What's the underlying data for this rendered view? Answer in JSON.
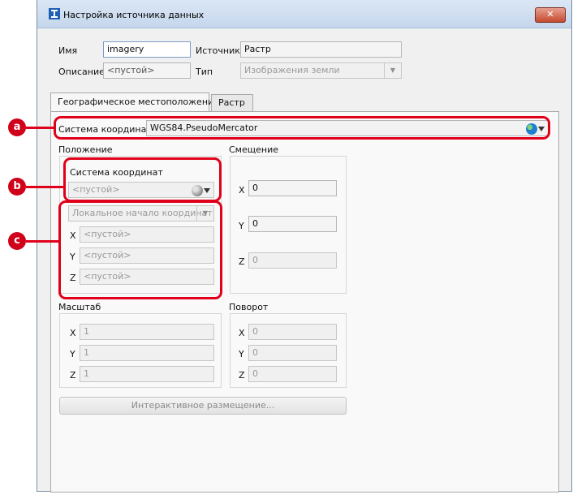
{
  "window": {
    "title": "Настройка источника данных",
    "close_glyph": "✕"
  },
  "form": {
    "name_label": "Имя",
    "name_value": "imagery",
    "source_label": "Источник",
    "source_value": "Растр",
    "description_label": "Описание",
    "description_value": "<пустой>",
    "type_label": "Тип",
    "type_value": "Изображения земли"
  },
  "tabs": [
    {
      "label": "Географическое местоположение",
      "active": true
    },
    {
      "label": "Растр",
      "active": false
    }
  ],
  "geo": {
    "crs_label": "Система координат",
    "crs_value": "WGS84.PseudoMercator",
    "position_label": "Положение",
    "position_crs_label": "Система координат",
    "position_crs_value": "<пустой>",
    "local_origin_value": "Локальное начало координат",
    "pos_x_label": "X",
    "pos_x_value": "<пустой>",
    "pos_y_label": "Y",
    "pos_y_value": "<пустой>",
    "pos_z_label": "Z",
    "pos_z_value": "<пустой>",
    "offset_label": "Смещение",
    "off_x_label": "X",
    "off_x_value": "0",
    "off_y_label": "Y",
    "off_y_value": "0",
    "off_z_label": "Z",
    "off_z_value": "0",
    "scale_label": "Масштаб",
    "sc_x_label": "X",
    "sc_x_value": "1",
    "sc_y_label": "Y",
    "sc_y_value": "1",
    "sc_z_label": "Z",
    "sc_z_value": "1",
    "rotation_label": "Поворот",
    "rot_x_label": "X",
    "rot_x_value": "0",
    "rot_y_label": "Y",
    "rot_y_value": "0",
    "rot_z_label": "Z",
    "rot_z_value": "0",
    "interactive_button": "Интерактивное размещение..."
  },
  "callouts": {
    "a": "a",
    "b": "b",
    "c": "c"
  },
  "colors": {
    "highlight": "#e0001a",
    "callout": "#d0021b"
  },
  "icons": {
    "globe": "globe-icon",
    "gray_globe": "gray-globe-icon"
  }
}
